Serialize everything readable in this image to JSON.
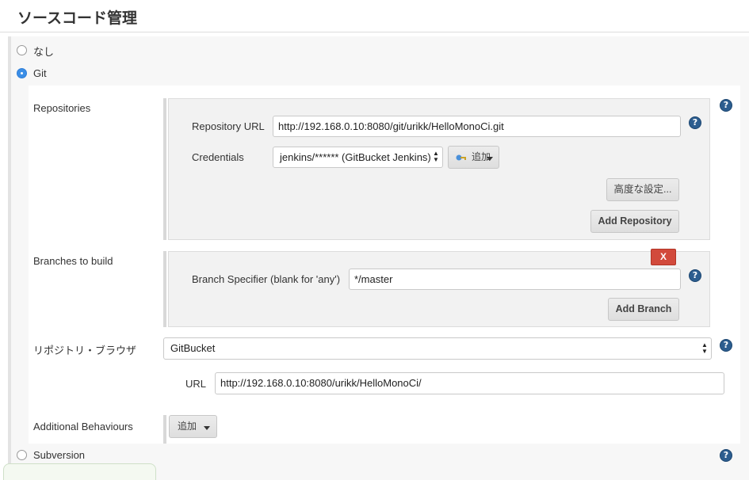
{
  "section_title": "ソースコード管理",
  "scm_options": {
    "none": "なし",
    "git": "Git",
    "subversion": "Subversion"
  },
  "repositories": {
    "label": "Repositories",
    "repo_url_label": "Repository URL",
    "repo_url_value": "http://192.168.0.10:8080/git/urikk/HelloMonoCi.git",
    "credentials_label": "Credentials",
    "credentials_value": "jenkins/****** (GitBucket Jenkins)",
    "add_credentials_label": "追加",
    "advanced_label": "高度な設定...",
    "add_repository_label": "Add Repository"
  },
  "branches": {
    "label": "Branches to build",
    "delete_label": "X",
    "specifier_label": "Branch Specifier (blank for 'any')",
    "specifier_value": "*/master",
    "add_branch_label": "Add Branch"
  },
  "repo_browser": {
    "label": "リポジトリ・ブラウザ",
    "value": "GitBucket",
    "url_label": "URL",
    "url_value": "http://192.168.0.10:8080/urikk/HelloMonoCi/"
  },
  "additional": {
    "label": "Additional Behaviours",
    "add_label": "追加"
  },
  "help_glyph": "?",
  "colors": {
    "help_icon": "#2c5d8f",
    "radio_selected": "#3b8ee6",
    "delete_button": "#d24a3c"
  }
}
